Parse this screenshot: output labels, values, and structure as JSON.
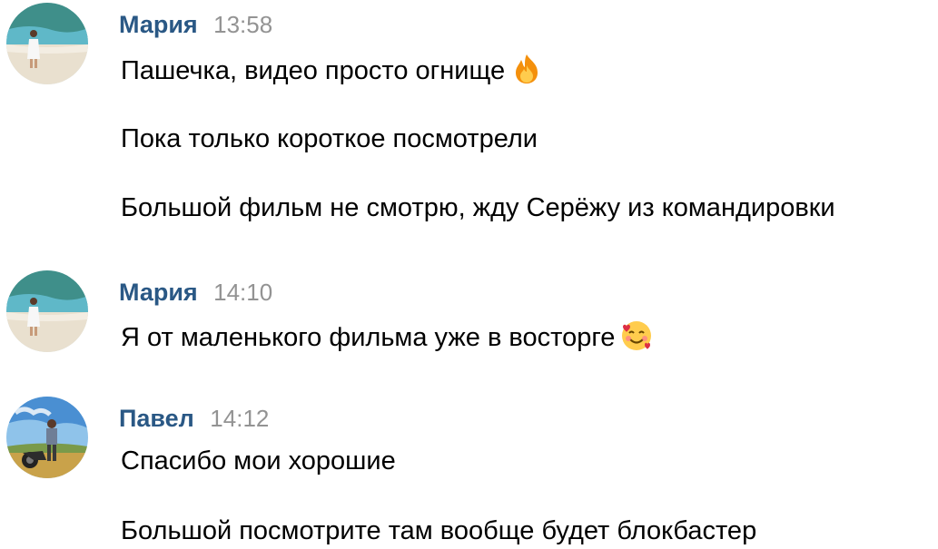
{
  "colors": {
    "author": "#2a5885",
    "time": "#939393",
    "text": "#000000",
    "background": "#ffffff"
  },
  "messages": [
    {
      "author": "Мария",
      "time": "13:58",
      "avatar_icon": "beach-photo-avatar",
      "lines": [
        {
          "text": "Пашечка, видео просто огнище",
          "emoji": "fire-emoji"
        },
        {
          "text": "Пока только короткое посмотрели"
        },
        {
          "text": "Большой фильм не смотрю, жду Серёжу из командировки"
        }
      ]
    },
    {
      "author": "Мария",
      "time": "14:10",
      "avatar_icon": "beach-photo-avatar",
      "lines": [
        {
          "text": "Я от маленького фильма уже в восторге",
          "emoji": "smiling-face-with-hearts-emoji"
        }
      ]
    },
    {
      "author": "Павел",
      "time": "14:12",
      "avatar_icon": "motorcycle-photo-avatar",
      "lines": [
        {
          "text": "Спасибо мои хорошие"
        },
        {
          "text": "Большой посмотрите там вообще будет блокбастер"
        }
      ]
    }
  ]
}
